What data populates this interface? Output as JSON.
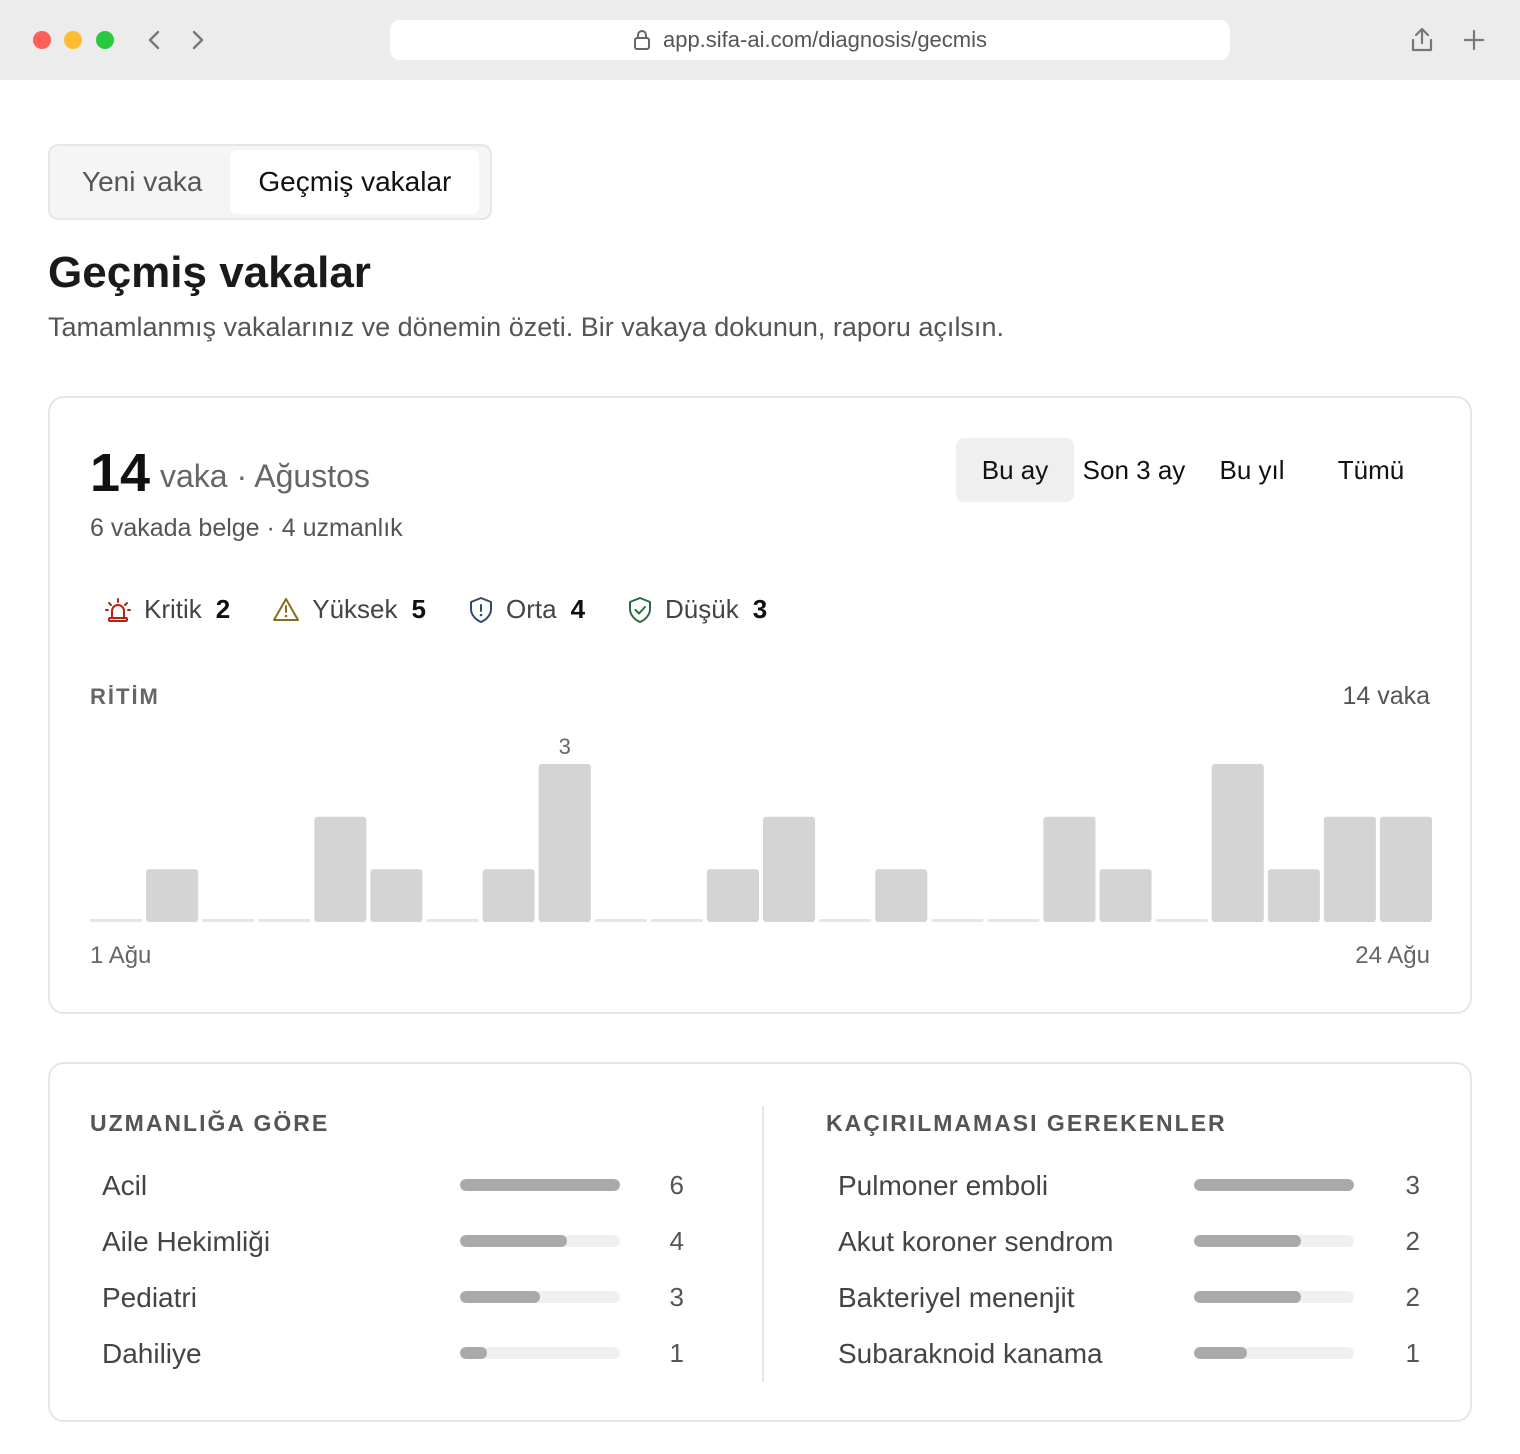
{
  "browser": {
    "url": "app.sifa-ai.com/diagnosis/gecmis",
    "icons": {
      "back": "chevron-left-icon",
      "forward": "chevron-right-icon",
      "lock": "lock-icon",
      "share": "share-icon",
      "new_tab": "plus-icon"
    }
  },
  "tabs": [
    {
      "label": "Yeni vaka",
      "active": false
    },
    {
      "label": "Geçmiş vakalar",
      "active": true
    }
  ],
  "page": {
    "title": "Geçmiş vakalar",
    "subtitle": "Tamamlanmış vakalarınız ve dönemin özeti. Bir vakaya dokunun, raporu açılsın."
  },
  "summary": {
    "count": "14",
    "count_label": "vaka · Ağustos",
    "sub": "6 vakada belge · 4 uzmanlık",
    "periods": [
      {
        "label": "Bu ay",
        "active": true
      },
      {
        "label": "Son 3 ay",
        "active": false
      },
      {
        "label": "Bu yıl",
        "active": false
      },
      {
        "label": "Tümü",
        "active": false
      }
    ],
    "severity": [
      {
        "label": "Kritik",
        "count": "2",
        "icon": "siren-icon",
        "color": "#b42318"
      },
      {
        "label": "Yüksek",
        "count": "5",
        "icon": "warning-triangle-icon",
        "color": "#8a6d1c"
      },
      {
        "label": "Orta",
        "count": "4",
        "icon": "shield-alert-icon",
        "color": "#2f4a6a"
      },
      {
        "label": "Düşük",
        "count": "3",
        "icon": "shield-check-icon",
        "color": "#2e6b3f"
      }
    ],
    "rhythm_label": "RİTİM",
    "rhythm_total": "14 vaka",
    "axis_start": "1 Ağu",
    "axis_end": "24 Ağu"
  },
  "chart_data": {
    "type": "bar",
    "x": [
      1,
      2,
      3,
      4,
      5,
      6,
      7,
      8,
      9,
      10,
      11,
      12,
      13,
      14,
      15,
      16,
      17,
      18,
      19,
      20,
      21,
      22,
      23,
      24
    ],
    "values": [
      0,
      1,
      0,
      0,
      2,
      1,
      0,
      1,
      3,
      0,
      0,
      1,
      2,
      0,
      1,
      0,
      0,
      2,
      1,
      0,
      3,
      1,
      2,
      2
    ],
    "ylim": [
      0,
      3
    ],
    "annotations": [
      {
        "x": 9,
        "label": "3"
      }
    ],
    "bar_color": "#d4d4d4",
    "zero_color": "#e6e6e6"
  },
  "by_specialty": {
    "title": "UZMANLIĞA GÖRE",
    "max": 6,
    "items": [
      {
        "label": "Acil",
        "value": 6,
        "display": "6"
      },
      {
        "label": "Aile Hekimliği",
        "value": 4,
        "display": "4"
      },
      {
        "label": "Pediatri",
        "value": 3,
        "display": "3"
      },
      {
        "label": "Dahiliye",
        "value": 1,
        "display": "1"
      }
    ]
  },
  "must_not_miss": {
    "title": "KAÇIRILMAMASI GEREKENLER",
    "max": 3,
    "items": [
      {
        "label": "Pulmoner emboli",
        "value": 3,
        "display": "3"
      },
      {
        "label": "Akut koroner sendrom",
        "value": 2,
        "display": "2"
      },
      {
        "label": "Bakteriyel menenjit",
        "value": 2,
        "display": "2"
      },
      {
        "label": "Subaraknoid kanama",
        "value": 1,
        "display": "1"
      }
    ]
  }
}
